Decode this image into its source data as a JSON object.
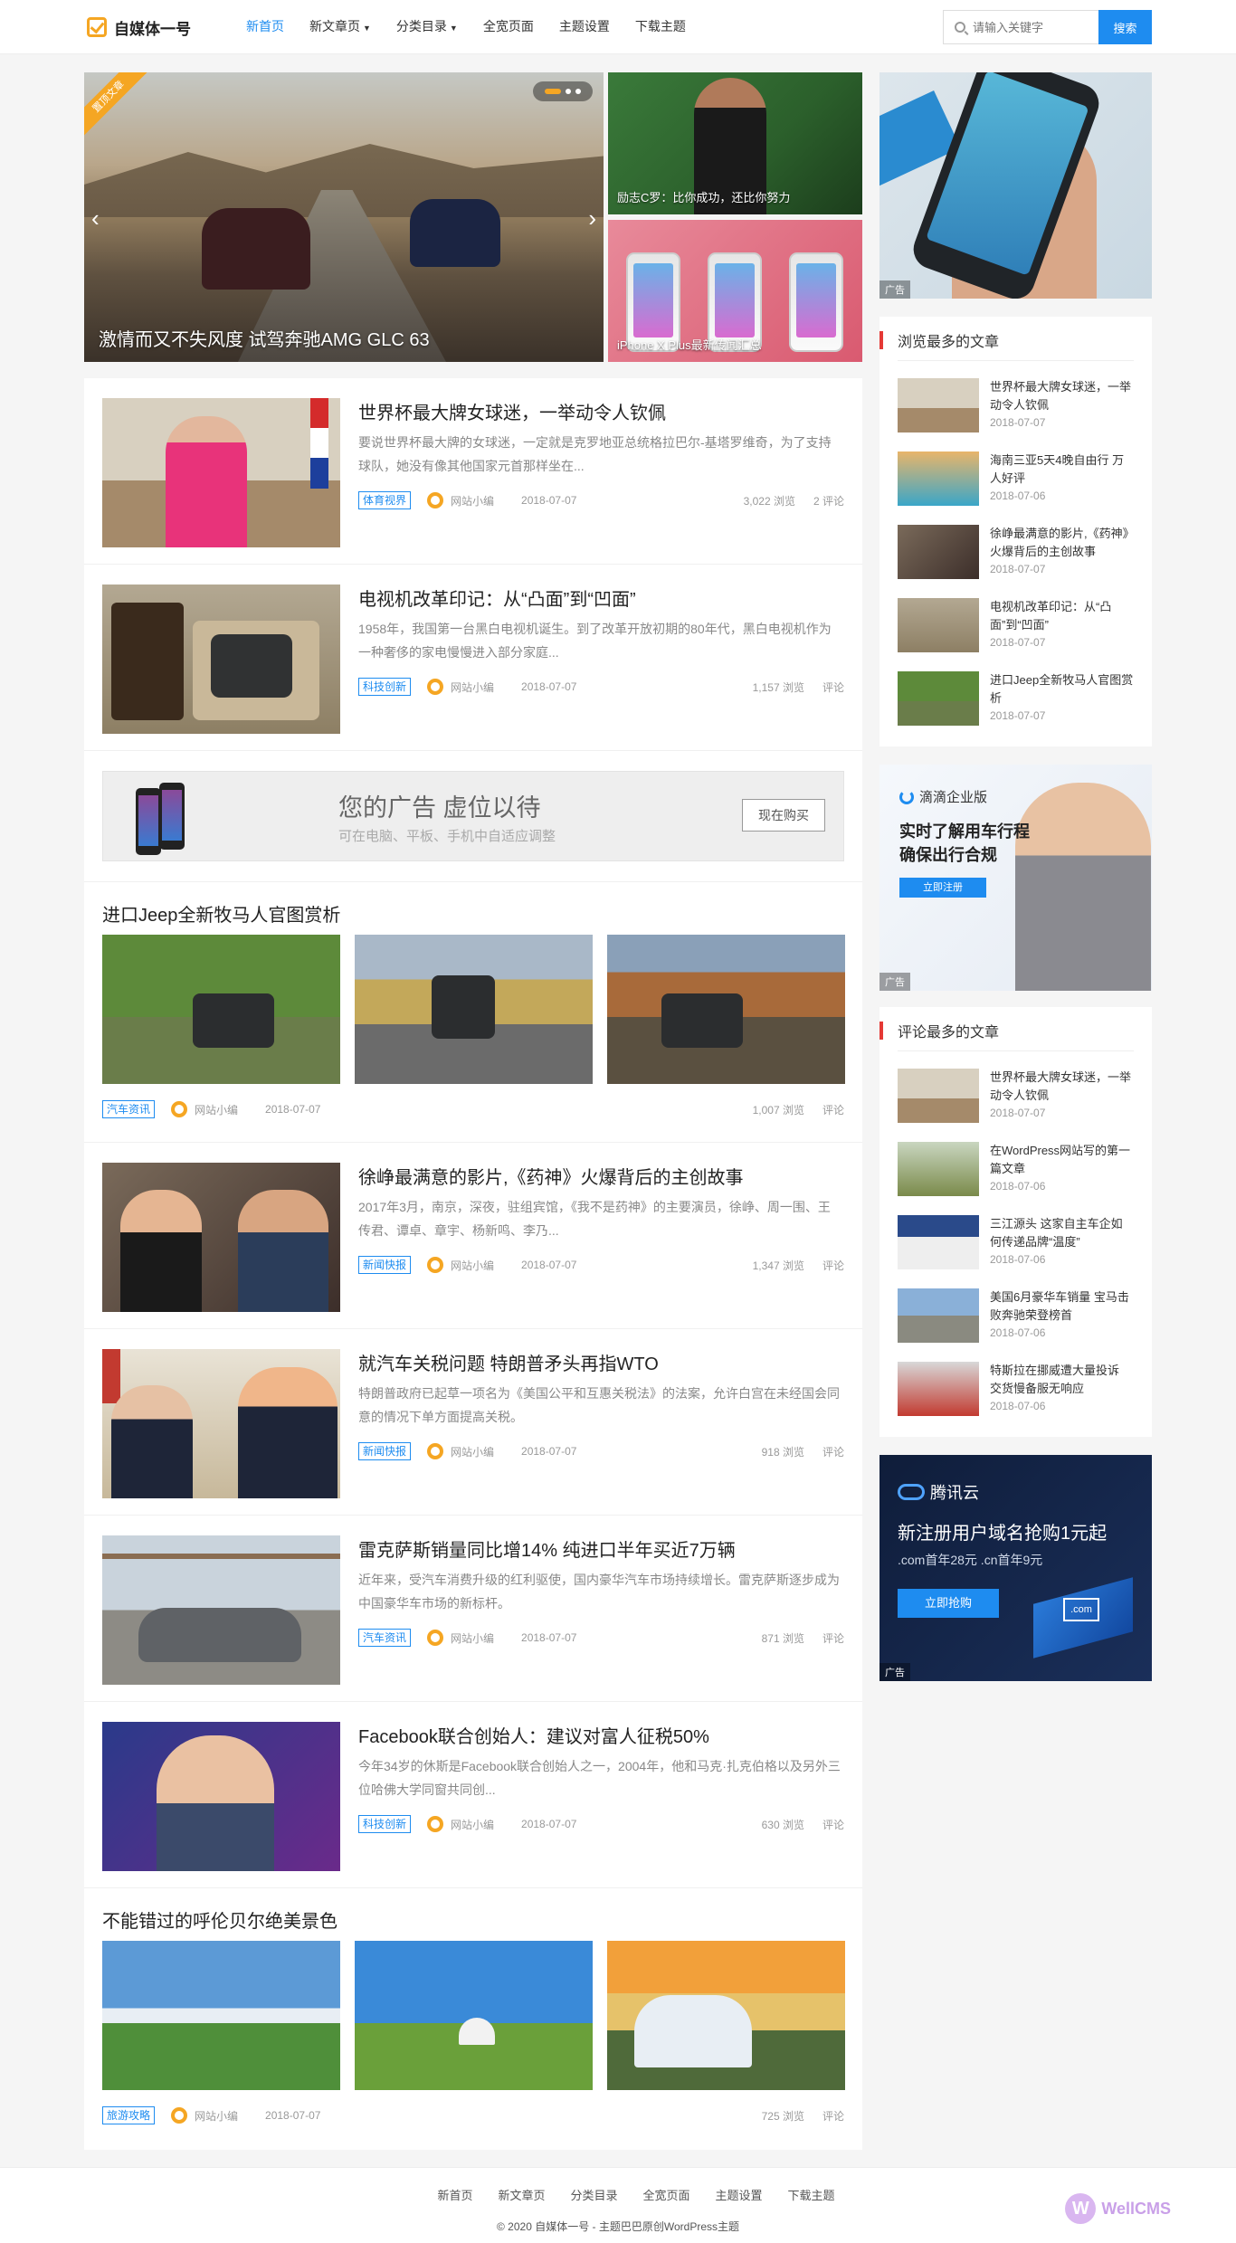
{
  "header": {
    "logo": "自媒体一号",
    "nav": [
      {
        "label": "新首页",
        "active": true
      },
      {
        "label": "新文章页",
        "caret": true
      },
      {
        "label": "分类目录",
        "caret": true
      },
      {
        "label": "全宽页面"
      },
      {
        "label": "主题设置"
      },
      {
        "label": "下载主题"
      }
    ],
    "search": {
      "placeholder": "请输入关键字",
      "button": "搜索"
    }
  },
  "slider": {
    "ribbon": "置顶文章",
    "caption": "激情而又不失风度 试驾奔驰AMG GLC 63",
    "side": [
      {
        "caption": "励志C罗：比你成功，还比你努力"
      },
      {
        "caption": "iPhone X Plus最新传闻汇总"
      }
    ]
  },
  "ads": {
    "tag": "广告",
    "banner": {
      "main": "您的广告 虚位以待",
      "sub": "可在电脑、平板、手机中自适应调整",
      "button": "现在购买"
    },
    "didi": {
      "brand": "滴滴企业版",
      "line1": "实时了解用车行程",
      "line2": "确保出行合规",
      "button": "立即注册"
    },
    "tencent": {
      "brand": "腾讯云",
      "line1": "新注册用户域名抢购1元起",
      "line2": ".com首年28元 .cn首年9元",
      "button": "立即抢购",
      "badge": ".com"
    }
  },
  "posts": [
    {
      "title": "世界杯最大牌女球迷，一举动令人钦佩",
      "excerpt": "要说世界杯最大牌的女球迷，一定就是克罗地亚总统格拉巴尔-基塔罗维奇，为了支持球队，她没有像其他国家元首那样坐在...",
      "tag": "体育视界",
      "author": "网站小编",
      "date": "2018-07-07",
      "views": "3,022 浏览",
      "comments": "2 评论"
    },
    {
      "title": "电视机改革印记：从“凸面”到“凹面”",
      "excerpt": "1958年，我国第一台黑白电视机诞生。到了改革开放初期的80年代，黑白电视机作为一种奢侈的家电慢慢进入部分家庭...",
      "tag": "科技创新",
      "author": "网站小编",
      "date": "2018-07-07",
      "views": "1,157 浏览",
      "comments": "评论"
    },
    {
      "title": "徐峥最满意的影片,《药神》火爆背后的主创故事",
      "excerpt": "2017年3月，南京，深夜，驻组宾馆，《我不是药神》的主要演员，徐峥、周一围、王传君、谭卓、章宇、杨新鸣、李乃...",
      "tag": "新闻快报",
      "author": "网站小编",
      "date": "2018-07-07",
      "views": "1,347 浏览",
      "comments": "评论"
    },
    {
      "title": "就汽车关税问题 特朗普矛头再指WTO",
      "excerpt": "特朗普政府已起草一项名为《美国公平和互惠关税法》的法案，允许白宫在未经国会同意的情况下单方面提高关税。",
      "tag": "新闻快报",
      "author": "网站小编",
      "date": "2018-07-07",
      "views": "918 浏览",
      "comments": "评论"
    },
    {
      "title": "雷克萨斯销量同比增14% 纯进口半年买近7万辆",
      "excerpt": "近年来，受汽车消费升级的红利驱使，国内豪华汽车市场持续增长。雷克萨斯逐步成为中国豪华车市场的新标杆。",
      "tag": "汽车资讯",
      "author": "网站小编",
      "date": "2018-07-07",
      "views": "871 浏览",
      "comments": "评论"
    },
    {
      "title": "Facebook联合创始人：建议对富人征税50%",
      "excerpt": "今年34岁的休斯是Facebook联合创始人之一，2004年，他和马克·扎克伯格以及另外三位哈佛大学同窗共同创...",
      "tag": "科技创新",
      "author": "网站小编",
      "date": "2018-07-07",
      "views": "630 浏览",
      "comments": "评论"
    }
  ],
  "galleries": [
    {
      "title": "进口Jeep全新牧马人官图赏析",
      "tag": "汽车资讯",
      "author": "网站小编",
      "date": "2018-07-07",
      "views": "1,007 浏览",
      "comments": "评论"
    },
    {
      "title": "不能错过的呼伦贝尔绝美景色",
      "tag": "旅游攻略",
      "author": "网站小编",
      "date": "2018-07-07",
      "views": "725 浏览",
      "comments": "评论"
    }
  ],
  "widgets": {
    "most_viewed": {
      "title": "浏览最多的文章",
      "items": [
        {
          "title": "世界杯最大牌女球迷，一举动令人钦佩",
          "date": "2018-07-07"
        },
        {
          "title": "海南三亚5天4晚自由行 万人好评",
          "date": "2018-07-06"
        },
        {
          "title": "徐峥最满意的影片,《药神》火爆背后的主创故事",
          "date": "2018-07-07"
        },
        {
          "title": "电视机改革印记：从“凸面”到“凹面”",
          "date": "2018-07-07"
        },
        {
          "title": "进口Jeep全新牧马人官图赏析",
          "date": "2018-07-07"
        }
      ]
    },
    "most_commented": {
      "title": "评论最多的文章",
      "items": [
        {
          "title": "世界杯最大牌女球迷，一举动令人钦佩",
          "date": "2018-07-07"
        },
        {
          "title": "在WordPress网站写的第一篇文章",
          "date": "2018-07-06"
        },
        {
          "title": "三江源头 这家自主车企如何传递品牌“温度”",
          "date": "2018-07-06"
        },
        {
          "title": "美国6月豪华车销量 宝马击败奔驰荣登榜首",
          "date": "2018-07-06"
        },
        {
          "title": "特斯拉在挪威遭大量投诉 交货慢备服无响应",
          "date": "2018-07-06"
        }
      ]
    }
  },
  "footer": {
    "nav": [
      "新首页",
      "新文章页",
      "分类目录",
      "全宽页面",
      "主题设置",
      "下载主题"
    ],
    "copyright": "© 2020 自媒体一号 - 主题巴巴原创WordPress主题",
    "watermark": "WellCMS"
  }
}
